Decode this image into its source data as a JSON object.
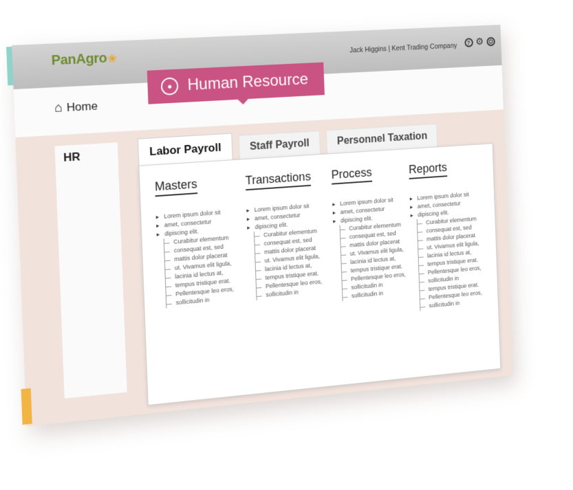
{
  "header": {
    "logo": "PanAgro",
    "user": "Jack Higgins",
    "separator": "|",
    "company": "Kent Trading Company",
    "icons": [
      "help-icon",
      "gear-icon",
      "power-icon"
    ]
  },
  "nav": {
    "home_label": "Home",
    "module_title": "Human Resource"
  },
  "side_tab": "HR",
  "tabs": [
    {
      "label": "Labor Payroll",
      "active": true
    },
    {
      "label": "Staff Payroll",
      "active": false
    },
    {
      "label": "Personnel Taxation",
      "active": false
    }
  ],
  "columns": [
    {
      "heading": "Masters",
      "bullets": [
        "Lorem ipsum dolor sit",
        "amet, consectetur",
        "dipiscing elit."
      ],
      "subitems": [
        "Curabitur elementum",
        "consequat est, sed",
        "mattis dolor placerat",
        "ut. Vivamus elit ligula,",
        "lacinia id lectus at,",
        "tempus tristique erat.",
        "Pellentesque leo eros,",
        "sollicitudin in"
      ]
    },
    {
      "heading": "Transactions",
      "bullets": [
        "Lorem ipsum dolor sit",
        "amet, consectetur",
        "dipiscing elit."
      ],
      "subitems": [
        "Curabitur elementum",
        "consequat est, sed",
        "mattis dolor placerat",
        "ut. Vivamus elit ligula,",
        "lacinia id lectus at,",
        "tempus tristique erat.",
        "Pellentesque leo eros,",
        "sollicitudin in"
      ]
    },
    {
      "heading": "Process",
      "bullets": [
        "Lorem ipsum dolor sit",
        "amet, consectetur",
        "dipiscing elit."
      ],
      "subitems": [
        "Curabitur elementum",
        "consequat est, sed",
        "mattis dolor placerat",
        "ut. Vivamus elit ligula,",
        "lacinia id lectus at,",
        "tempus tristique erat.",
        "Pellentesque leo eros,",
        "sollicitudin in",
        "sollicitudin in"
      ]
    },
    {
      "heading": "Reports",
      "bullets": [
        "Lorem ipsum dolor sit",
        "amet, consectetur",
        "dipiscing elit."
      ],
      "subitems": [
        "Curabitur elementum",
        "consequat est, sed",
        "mattis dolor placerat",
        "ut. Vivamus elit ligula,",
        "lacinia id lectus at,",
        "tempus tristique erat.",
        "Pellentesque leo eros,",
        "sollicitudin in",
        "tempus tristique erat.",
        "Pellentesque leo eros,",
        "sollicitudin in"
      ]
    }
  ],
  "colors": {
    "accent": "#c95382",
    "logo_green": "#6e8c2e",
    "logo_leaf": "#e8a52b",
    "frame": "#f1e2dc",
    "header": "#c8c8c8"
  }
}
